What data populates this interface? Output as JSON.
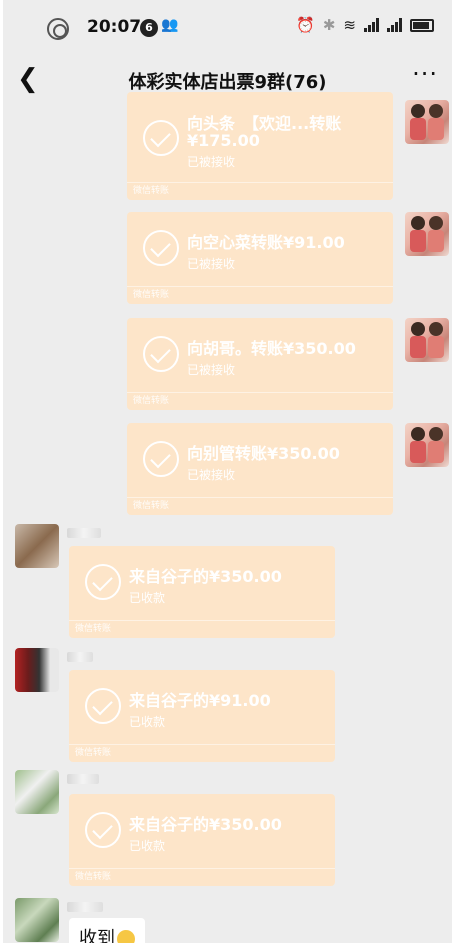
{
  "status_bar": {
    "time": "20:07",
    "notification_count": "6"
  },
  "nav": {
    "back_icon": "chevron-left-icon",
    "title": "体彩实体店出票9群(76)",
    "more_icon": "more-dots-icon"
  },
  "messages": {
    "sent": [
      {
        "title": "向头条　【欢迎...转账",
        "amount": "¥175.00",
        "status": "已被接收",
        "footer": "微信转账"
      },
      {
        "title": "向空心菜转账¥91.00",
        "status": "已被接收",
        "footer": "微信转账"
      },
      {
        "title": "向胡哥。转账¥350.00",
        "status": "已被接收",
        "footer": "微信转账"
      },
      {
        "title": "向别管转账¥350.00",
        "status": "已被接收",
        "footer": "微信转账"
      }
    ],
    "received": [
      {
        "title": "来自谷子的¥350.00",
        "status": "已收款",
        "footer": "微信转账"
      },
      {
        "title": "来自谷子的¥91.00",
        "status": "已收款",
        "footer": "微信转账"
      },
      {
        "title": "来自谷子的¥350.00",
        "status": "已收款",
        "footer": "微信转账"
      }
    ],
    "last_text": "收到"
  },
  "colors": {
    "chat_background": "#ededed",
    "transfer_received_bg": "#fde5c9"
  }
}
